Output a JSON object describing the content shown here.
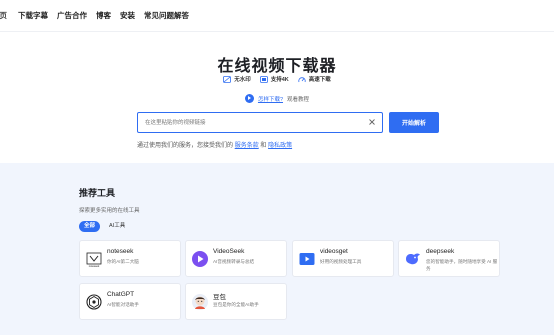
{
  "nav": {
    "items": [
      {
        "label": "首页"
      },
      {
        "label": "下载字幕"
      },
      {
        "label": "广告合作"
      },
      {
        "label": "博客"
      },
      {
        "label": "安装"
      },
      {
        "label": "常见问题解答"
      }
    ]
  },
  "hero": {
    "title": "在线视频下载器",
    "features": [
      {
        "icon": "no-watermark-icon",
        "label": "无水印"
      },
      {
        "icon": "4k-icon",
        "label": "支持4K"
      },
      {
        "icon": "speed-icon",
        "label": "高速下载"
      }
    ],
    "howto_link": "怎样下载?",
    "howto_text": "观看教程"
  },
  "search": {
    "placeholder": "在这里粘贴你的视频链接",
    "value": "",
    "button_label": "开始解析"
  },
  "terms": {
    "prefix": "通过使用我们的服务，您接受我们的",
    "terms_link": "服务条款",
    "conjunction": "和",
    "privacy_link": "隐私政策"
  },
  "tools": {
    "title": "推荐工具",
    "subtitle": "探索更多实用的在线工具",
    "tabs": [
      {
        "label": "全部",
        "active": true
      },
      {
        "label": "AI工具",
        "active": false
      }
    ],
    "cards": [
      {
        "name": "noteseek",
        "desc": "你的AI第二大脑",
        "icon": "noteseek-logo-icon"
      },
      {
        "name": "VideoSeek",
        "desc": "AI音视频转录与总结",
        "icon": "videoseek-logo-icon"
      },
      {
        "name": "videosget",
        "desc": "好用的视频处理工具",
        "icon": "videosget-logo-icon"
      },
      {
        "name": "deepseek",
        "desc": "您的智能助手，随时随地享受 AI 服务",
        "icon": "deepseek-logo-icon"
      },
      {
        "name": "ChatGPT",
        "desc": "AI智能对话助手",
        "icon": "chatgpt-logo-icon"
      },
      {
        "name": "豆包",
        "desc": "豆包是你的全能AI助手",
        "icon": "doubao-logo-icon"
      }
    ]
  },
  "colors": {
    "accent": "#2f6df2",
    "section_bg": "#f1f5fd"
  }
}
